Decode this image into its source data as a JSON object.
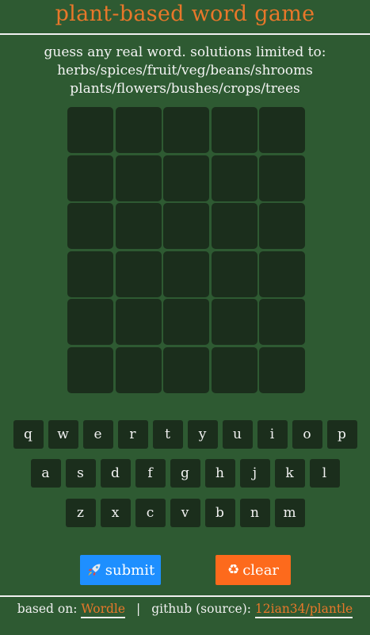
{
  "header": {
    "title": "plant-based word game"
  },
  "instructions": {
    "line1": "guess any real word. solutions limited to:",
    "line2": "herbs/spices/fruit/veg/beans/shrooms",
    "line3": "plants/flowers/bushes/crops/trees"
  },
  "board": {
    "rows": 6,
    "columns": 5,
    "guesses": [],
    "empty_cell_color": "#1b2e1c"
  },
  "keyboard": {
    "row1": [
      "q",
      "w",
      "e",
      "r",
      "t",
      "y",
      "u",
      "i",
      "o",
      "p"
    ],
    "row2": [
      "a",
      "s",
      "d",
      "f",
      "g",
      "h",
      "j",
      "k",
      "l"
    ],
    "row3": [
      "z",
      "x",
      "c",
      "v",
      "b",
      "n",
      "m"
    ]
  },
  "actions": {
    "submit_label": "submit",
    "submit_icon": "rocket-icon",
    "clear_label": "clear",
    "clear_icon": "recycle-icon",
    "submit_color": "#1e8fff",
    "clear_color": "#fd6a1c"
  },
  "footer": {
    "based_on_prefix": "based on:",
    "based_on_link": "Wordle",
    "separator": "|",
    "github_prefix": "github (source):",
    "github_link": "12ian34/plantle"
  },
  "colors": {
    "background": "#2e5a32",
    "accent": "#e8772a"
  }
}
